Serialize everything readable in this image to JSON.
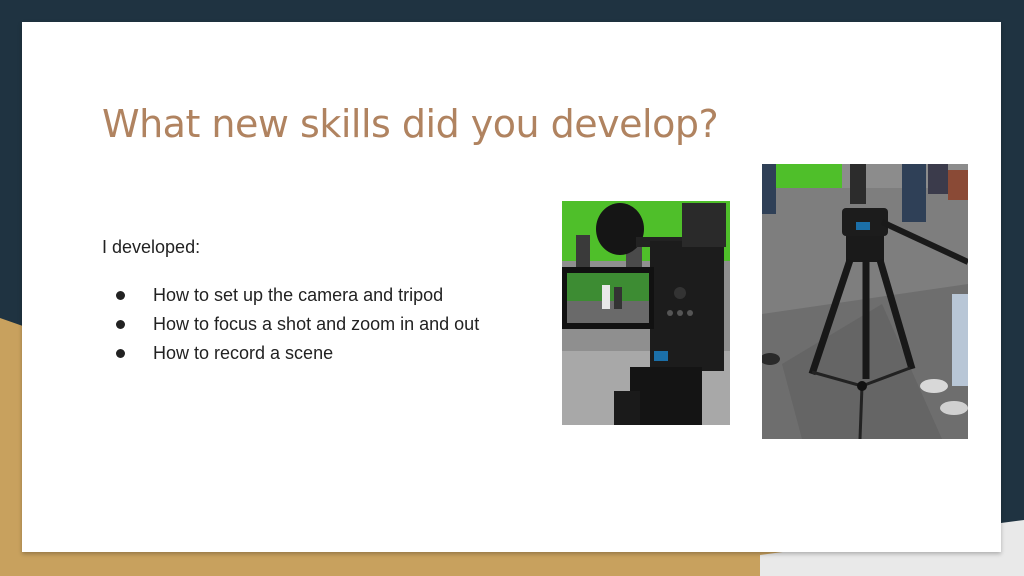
{
  "slide": {
    "title": "What new skills did you develop?",
    "intro": "I developed:",
    "bullets": [
      "How to set up the camera and tripod",
      "How to focus a shot and zoom in and out",
      "How to record a scene"
    ]
  },
  "images": {
    "camera_photo": "photo-camera-on-tripod-green-screen",
    "tripod_photo": "photo-tripod-in-studio"
  },
  "colors": {
    "background_dark": "#1f3341",
    "background_gold": "#c8a15e",
    "slide": "#ffffff",
    "title": "#b08360",
    "text": "#222222",
    "green_screen": "#4fbf2a"
  }
}
